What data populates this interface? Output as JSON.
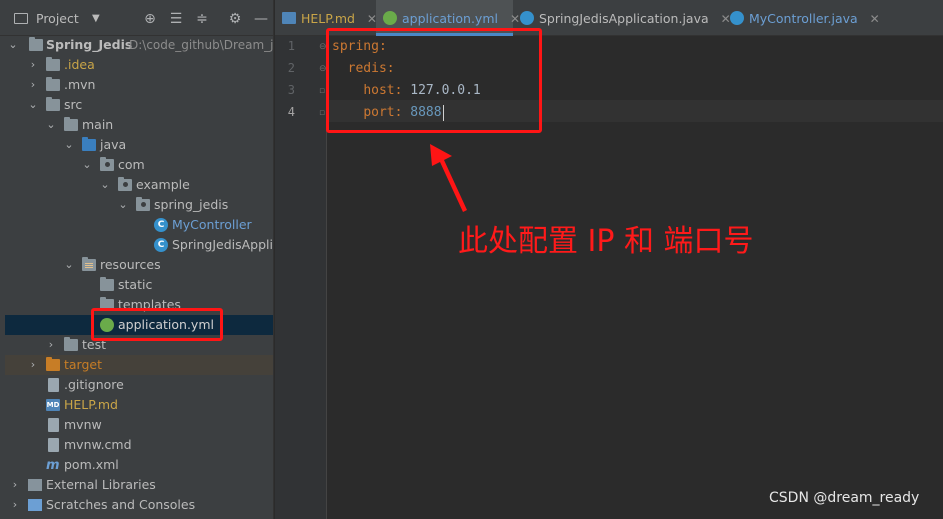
{
  "panel": {
    "title": "Project",
    "toolbar_icons": [
      "target-icon",
      "collapse-icon",
      "expand-icon",
      "gear-icon",
      "minimize-icon"
    ]
  },
  "tree": {
    "root_name": "Spring_Jedis",
    "root_path": "D:\\code_github\\Dream_ja",
    "idea": ".idea",
    "mvn": ".mvn",
    "src": "src",
    "main": "main",
    "java": "java",
    "com": "com",
    "example": "example",
    "spring_jedis": "spring_jedis",
    "mycontroller": "MyController",
    "springjedisapp": "SpringJedisApplic",
    "resources": "resources",
    "static": "static",
    "templates": "templates",
    "application_yml": "application.yml",
    "test": "test",
    "target": "target",
    "gitignore": ".gitignore",
    "help_md": "HELP.md",
    "mvnw": "mvnw",
    "mvnw_cmd": "mvnw.cmd",
    "pom_xml": "pom.xml",
    "external_libraries": "External Libraries",
    "scratches": "Scratches and Consoles",
    "md_badge": "MD"
  },
  "tabs": [
    {
      "label": "HELP.md",
      "close": "✕"
    },
    {
      "label": "application.yml",
      "close": "✕"
    },
    {
      "label": "SpringJedisApplication.java",
      "close": "✕"
    },
    {
      "label": "MyController.java",
      "close": "✕"
    }
  ],
  "editor": {
    "line_numbers": [
      "1",
      "2",
      "3",
      "4"
    ],
    "code": {
      "spring_key": "spring",
      "redis_key": "redis",
      "host_key": "host",
      "host_value": "127.0.0.1",
      "port_key": "port",
      "port_value": "8888",
      "colon": ":"
    }
  },
  "annotation": "此处配置 IP 和 端口号",
  "watermark": "CSDN @dream_ready",
  "colors": {
    "highlight_red": "#ff1515",
    "keyword_orange": "#cc7832",
    "number_blue": "#6897bb",
    "selection": "#0d293e",
    "tab_underline": "#4a88c7"
  }
}
